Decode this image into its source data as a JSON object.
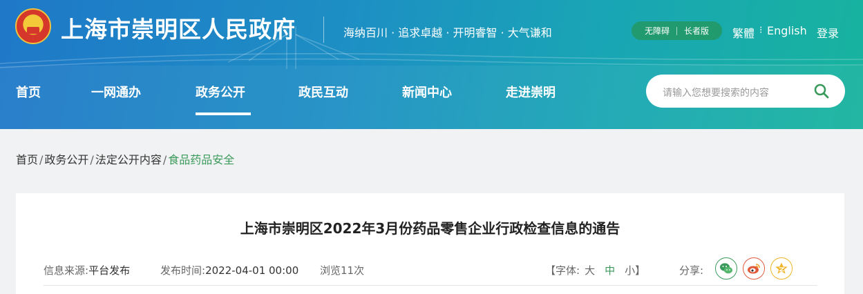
{
  "header": {
    "site_title": "上海市崇明区人民政府",
    "slogan": "海纳百川 · 追求卓越 · 开明睿智 · 大气谦和",
    "accessibility": "无障碍",
    "elder_mode": "长者版",
    "lang_traditional": "繁體",
    "lang_english": "English",
    "login": "登录"
  },
  "nav": {
    "items": [
      {
        "label": "首页"
      },
      {
        "label": "一网通办"
      },
      {
        "label": "政务公开"
      },
      {
        "label": "政民互动"
      },
      {
        "label": "新闻中心"
      },
      {
        "label": "走进崇明"
      }
    ],
    "active_index": 2
  },
  "search": {
    "placeholder": "请输入您想要搜索的内容"
  },
  "breadcrumb": {
    "items": [
      "首页",
      "政务公开",
      "法定公开内容",
      "食品药品安全"
    ],
    "separator": "/"
  },
  "article": {
    "title": "上海市崇明区2022年3月份药品零售企业行政检查信息的通告",
    "source_label": "信息来源:",
    "source_value": "平台发布",
    "date_label": "发布时间:",
    "date_value": "2022-04-01 00:00",
    "views": "浏览11次",
    "font_label": "【字体:",
    "font_large": "大",
    "font_medium": "中",
    "font_small": "小】",
    "share_label": "分享:"
  },
  "share": [
    {
      "icon": "wechat-icon",
      "color": "#3a9a5b"
    },
    {
      "icon": "weibo-icon",
      "color": "#e05a3a"
    },
    {
      "icon": "qzone-icon",
      "color": "#f0b428"
    }
  ],
  "colors": {
    "accent_green": "#3a9a5b",
    "header_start": "#1f78c8",
    "header_end": "#18b39e"
  }
}
